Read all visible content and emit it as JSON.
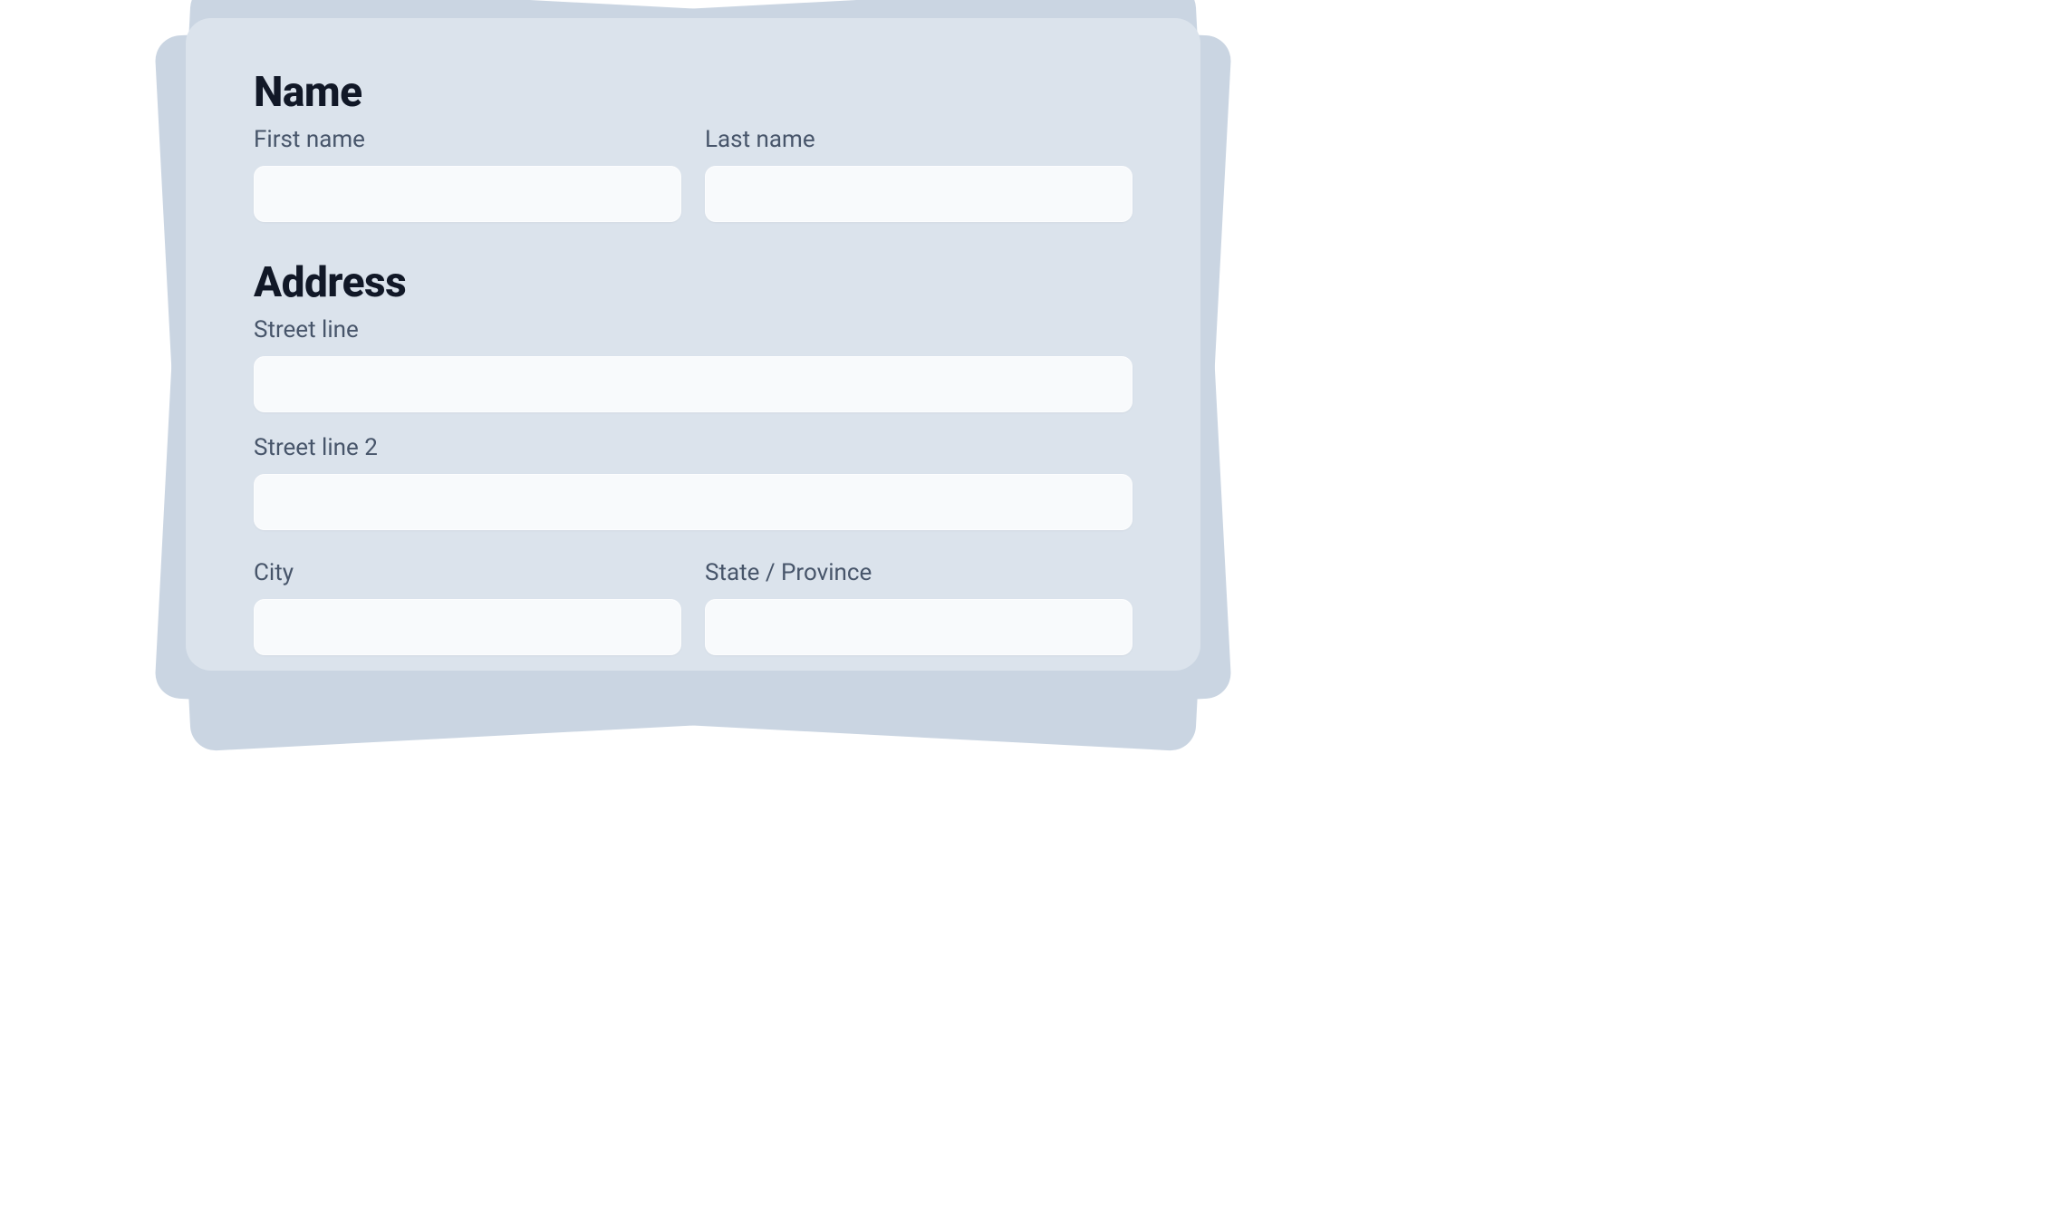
{
  "form": {
    "name": {
      "heading": "Name",
      "first_name_label": "First name",
      "first_name_value": "",
      "last_name_label": "Last name",
      "last_name_value": ""
    },
    "address": {
      "heading": "Address",
      "street_line_label": "Street line",
      "street_line_value": "",
      "street_line_2_label": "Street line 2",
      "street_line_2_value": "",
      "city_label": "City",
      "city_value": "",
      "state_label": "State / Province",
      "state_value": ""
    }
  }
}
